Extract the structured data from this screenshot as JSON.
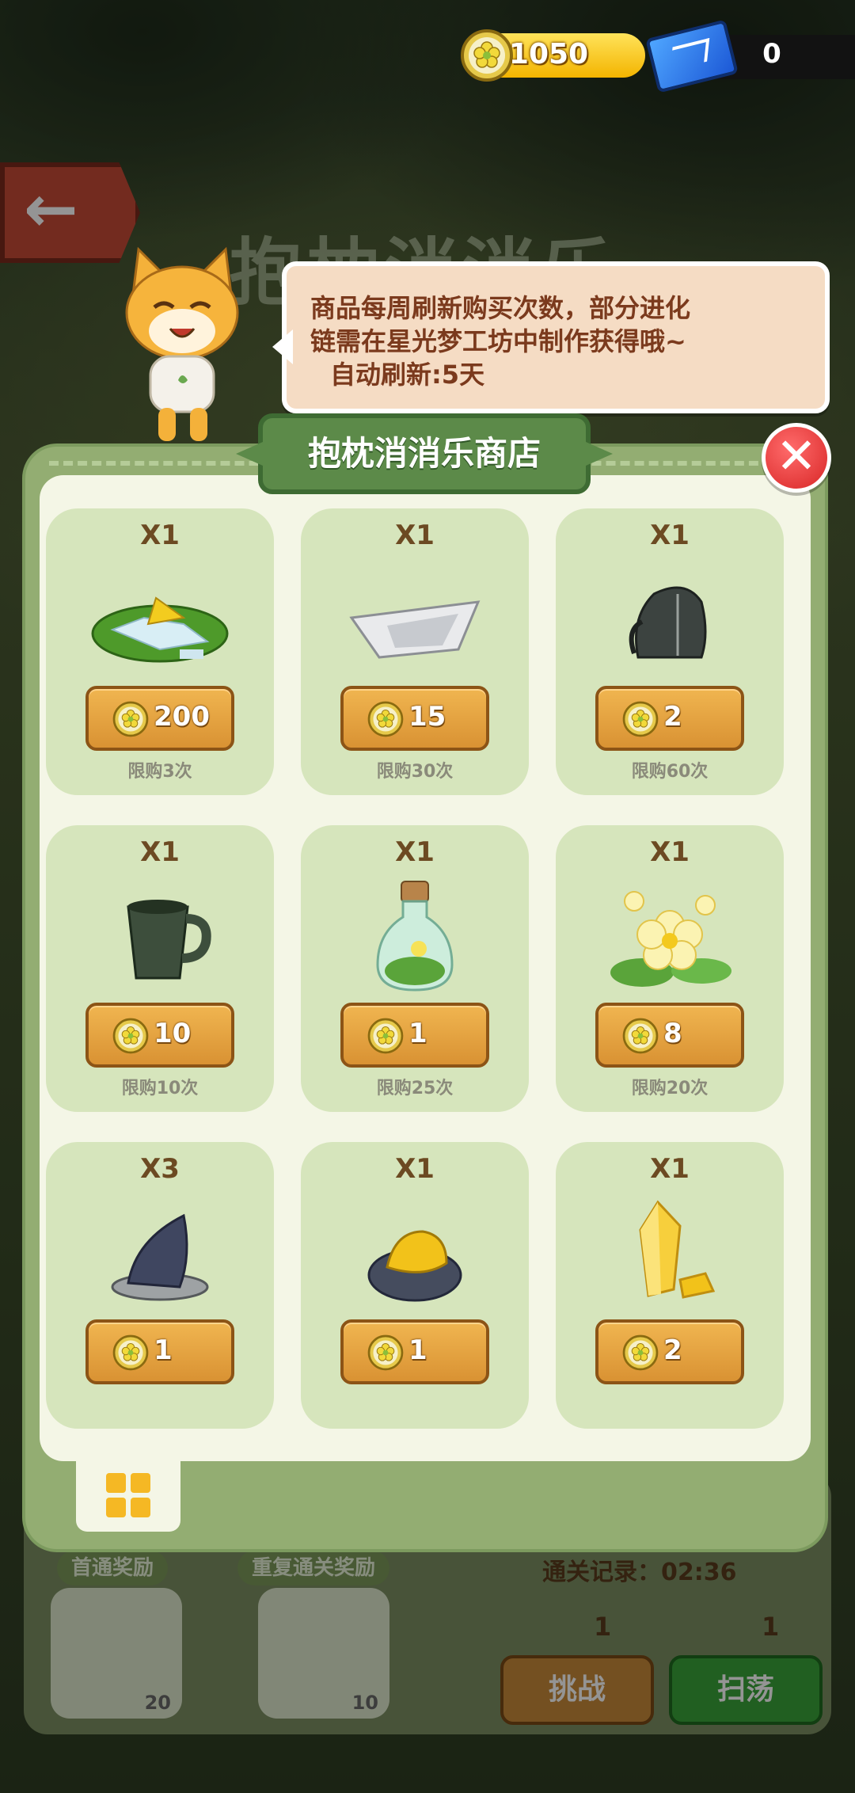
{
  "currency": {
    "coins": "1050",
    "tickets": "0"
  },
  "background": {
    "title": "抱枕消消乐",
    "first_clear_label": "首通奖励",
    "repeat_clear_label": "重复通关奖励",
    "first_clear_amount": "20",
    "repeat_clear_amount": "10",
    "record": "通关记录：02:36",
    "challenge_cost": "1",
    "sweep_cost": "1",
    "challenge_label": "挑战",
    "sweep_label": "扫荡"
  },
  "bubble": {
    "line1": "商品每周刷新购买次数，部分进化",
    "line2": "链需在星光梦工坊中制作获得哦~",
    "line3": "自动刷新:5天"
  },
  "shop": {
    "title": "抱枕消消乐商店",
    "items": [
      {
        "qty": "X1",
        "price": "200",
        "limit": "限购3次",
        "icon": "grass-patch-icon"
      },
      {
        "qty": "X1",
        "price": "15",
        "limit": "限购30次",
        "icon": "paper-boat-icon"
      },
      {
        "qty": "X1",
        "price": "2",
        "limit": "限购60次",
        "icon": "backpack-icon"
      },
      {
        "qty": "X1",
        "price": "10",
        "limit": "限购10次",
        "icon": "mug-icon"
      },
      {
        "qty": "X1",
        "price": "1",
        "limit": "限购25次",
        "icon": "bottle-icon"
      },
      {
        "qty": "X1",
        "price": "8",
        "limit": "限购20次",
        "icon": "flower-icon"
      },
      {
        "qty": "X3",
        "price": "1",
        "limit": "",
        "icon": "stone-icon"
      },
      {
        "qty": "X1",
        "price": "1",
        "limit": "",
        "icon": "gold-ore-icon"
      },
      {
        "qty": "X1",
        "price": "2",
        "limit": "",
        "icon": "crystal-icon"
      }
    ]
  },
  "colors": {
    "panel_green": "#93ad72",
    "card_green": "#d6e5bc",
    "price_orange": "#d99233",
    "close_red": "#d82626"
  }
}
